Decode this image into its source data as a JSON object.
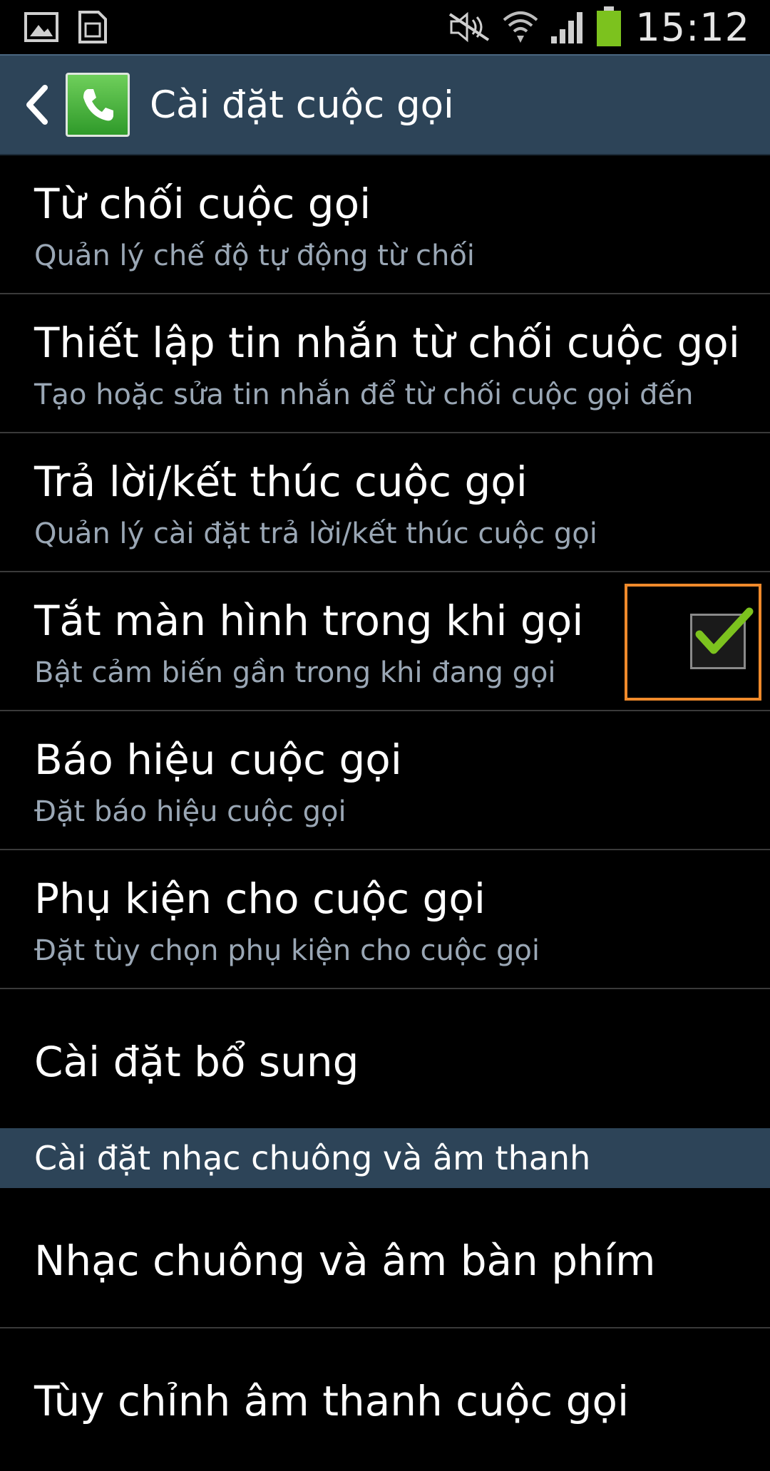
{
  "status_bar": {
    "time": "15:12",
    "left_icons": [
      "gallery-icon",
      "sim-card-icon"
    ],
    "right_icons": [
      "mute-icon",
      "wifi-icon",
      "signal-icon",
      "battery-icon"
    ],
    "battery_color": "#7cc21e"
  },
  "action_bar": {
    "title": "Cài đặt cuộc gọi",
    "background": "#2d4458"
  },
  "items": [
    {
      "title": "Từ chối cuộc gọi",
      "subtitle": "Quản lý chế độ tự động từ chối"
    },
    {
      "title": "Thiết lập tin nhắn từ chối cuộc gọi",
      "subtitle": "Tạo hoặc sửa tin nhắn để từ chối cuộc gọi đến"
    },
    {
      "title": "Trả lời/kết thúc cuộc gọi",
      "subtitle": "Quản lý cài đặt trả lời/kết thúc cuộc gọi"
    },
    {
      "title": "Tắt màn hình trong khi gọi",
      "subtitle": "Bật cảm biến gần trong khi đang gọi",
      "checked": true
    },
    {
      "title": "Báo hiệu cuộc gọi",
      "subtitle": "Đặt báo hiệu cuộc gọi"
    },
    {
      "title": "Phụ kiện cho cuộc gọi",
      "subtitle": "Đặt tùy chọn phụ kiện cho cuộc gọi"
    },
    {
      "title": "Cài đặt bổ sung"
    }
  ],
  "section": {
    "title": "Cài đặt nhạc chuông và âm thanh"
  },
  "section_items": [
    {
      "title": "Nhạc chuông và âm bàn phím"
    },
    {
      "title": "Tùy chỉnh âm thanh cuộc gọi"
    }
  ],
  "highlight_color": "#f08a2b",
  "check_color": "#7cc21e"
}
